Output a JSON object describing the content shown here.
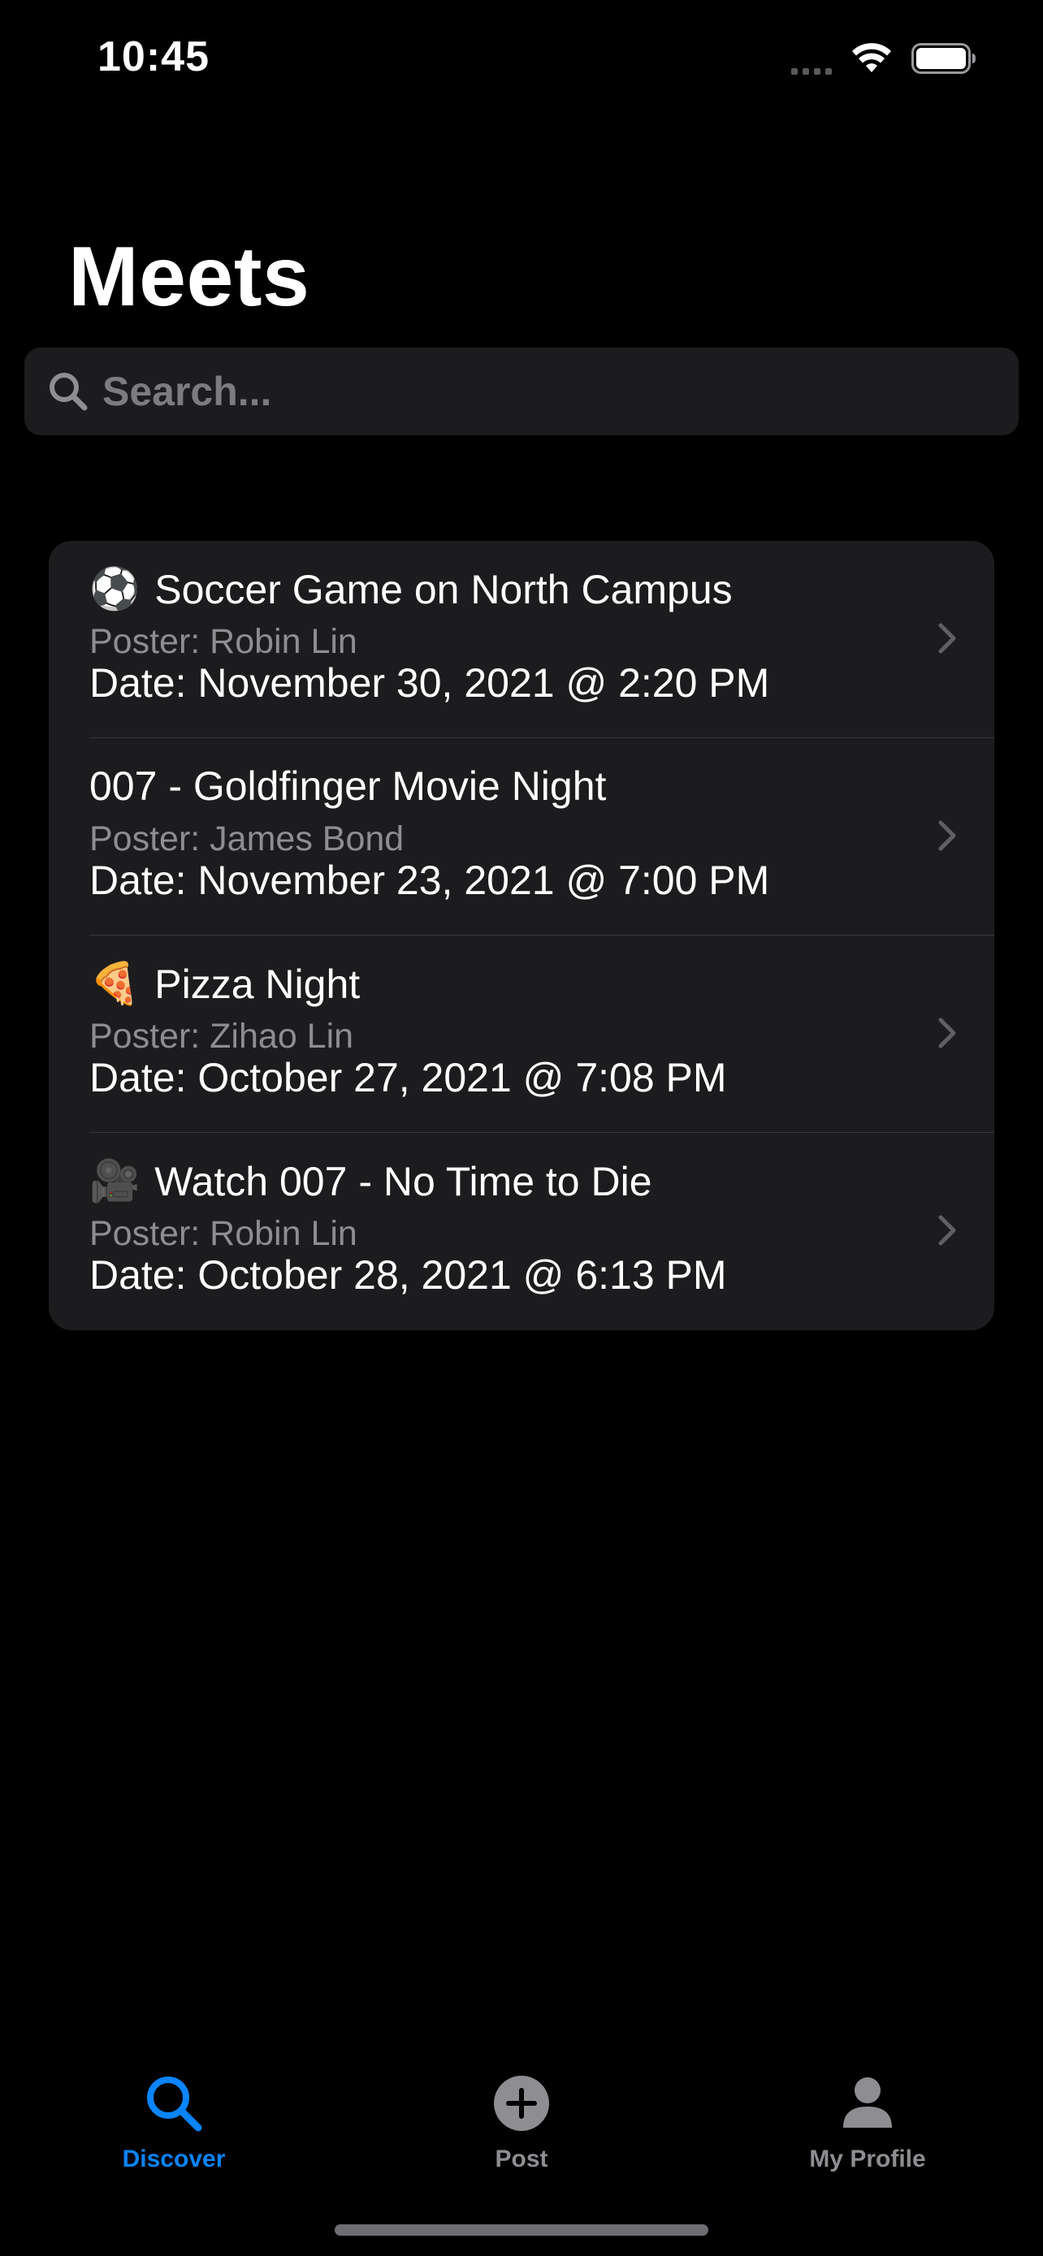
{
  "status_bar": {
    "time": "10:45"
  },
  "header": {
    "title": "Meets"
  },
  "search": {
    "placeholder": "Search...",
    "value": ""
  },
  "meets": [
    {
      "emoji": "⚽",
      "title": "Soccer Game on North Campus",
      "poster": "Poster: Robin Lin",
      "date": "Date: November 30, 2021 @ 2:20 PM"
    },
    {
      "emoji": "",
      "title": "007 - Goldfinger Movie Night",
      "poster": "Poster: James Bond",
      "date": "Date: November 23, 2021 @ 7:00 PM"
    },
    {
      "emoji": "🍕",
      "title": "Pizza Night",
      "poster": "Poster: Zihao Lin",
      "date": "Date: October 27, 2021 @ 7:08 PM"
    },
    {
      "emoji": "🎥",
      "title": "Watch 007 - No Time to Die",
      "poster": "Poster: Robin Lin",
      "date": "Date: October 28, 2021 @ 6:13 PM"
    }
  ],
  "tab_bar": {
    "discover": "Discover",
    "post": "Post",
    "profile": "My Profile",
    "active_tab": "discover"
  },
  "colors": {
    "accent": "#0a84ff",
    "background": "#000000",
    "card": "#1c1c1e",
    "secondary_text": "#8d8d92"
  },
  "icons": {
    "search": "search-icon",
    "chevron": "chevron-right-icon",
    "discover": "magnifying-glass-icon",
    "post": "plus-circle-icon",
    "profile": "person-icon",
    "wifi": "wifi-icon",
    "battery": "battery-icon",
    "signal": "cellular-signal-icon"
  }
}
